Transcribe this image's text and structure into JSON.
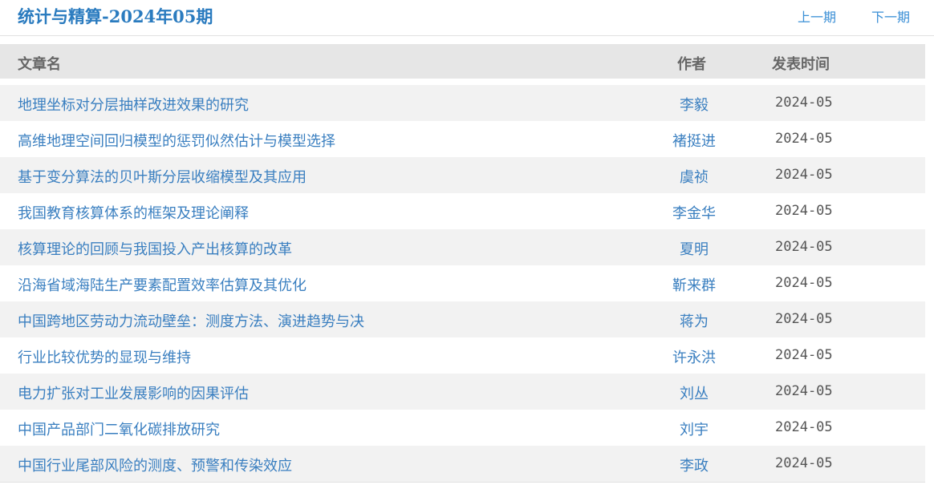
{
  "header": {
    "title": "统计与精算-2024年05期",
    "prev_label": "上一期",
    "next_label": "下一期"
  },
  "table": {
    "columns": [
      "文章名",
      "作者",
      "发表时间"
    ],
    "rows": [
      {
        "title": "地理坐标对分层抽样改进效果的研究",
        "author": "李毅",
        "date": "2024-05"
      },
      {
        "title": "高维地理空间回归模型的惩罚似然估计与模型选择",
        "author": "褚挺进",
        "date": "2024-05"
      },
      {
        "title": "基于变分算法的贝叶斯分层收缩模型及其应用",
        "author": "虞祯",
        "date": "2024-05"
      },
      {
        "title": "我国教育核算体系的框架及理论阐释",
        "author": "李金华",
        "date": "2024-05"
      },
      {
        "title": "核算理论的回顾与我国投入产出核算的改革",
        "author": "夏明",
        "date": "2024-05"
      },
      {
        "title": "沿海省域海陆生产要素配置效率估算及其优化",
        "author": "靳来群",
        "date": "2024-05"
      },
      {
        "title": "中国跨地区劳动力流动壁垒：测度方法、演进趋势与决",
        "author": "蒋为",
        "date": "2024-05"
      },
      {
        "title": "行业比较优势的显现与维持",
        "author": "许永洪",
        "date": "2024-05"
      },
      {
        "title": "电力扩张对工业发展影响的因果评估",
        "author": "刘丛",
        "date": "2024-05"
      },
      {
        "title": "中国产品部门二氧化碳排放研究",
        "author": "刘宇",
        "date": "2024-05"
      },
      {
        "title": "中国行业尾部风险的测度、预警和传染效应",
        "author": "李政",
        "date": "2024-05"
      }
    ]
  }
}
